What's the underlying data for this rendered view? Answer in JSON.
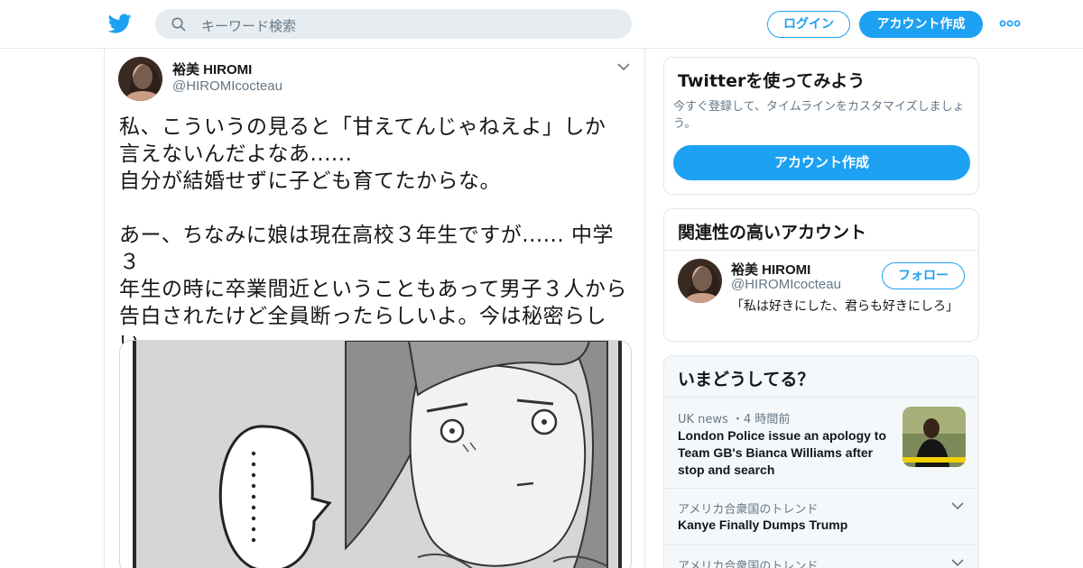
{
  "header": {
    "search_placeholder": "キーワード検索",
    "login_label": "ログイン",
    "signup_label": "アカウント作成",
    "accent_color": "#1da1f2"
  },
  "tweet": {
    "author_name": "裕美 HIROMI",
    "author_handle": "@HIROMIcocteau",
    "text": "私、こういうの見ると「甘えてんじゃねえよ」しか\n言えないんだよなあ......\n自分が結婚せずに子ども育てたからな。\n\nあー、ちなみに娘は現在高校３年生ですが...... 中学３\n年生の時に卒業間近ということもあって男子３人から\n告白されたけど全員断ったらしいよ。今は秘密らし\nい。"
  },
  "sidebar": {
    "signup_card": {
      "title": "Twitterを使ってみよう",
      "description": "今すぐ登録して、タイムラインをカスタマイズしましょう。",
      "cta_label": "アカウント作成"
    },
    "related_card": {
      "title": "関連性の高いアカウント",
      "account": {
        "name": "裕美 HIROMI",
        "handle": "@HIROMIcocteau",
        "follow_label": "フォロー",
        "bio": "「私は好きにした、君らも好きにしろ」"
      }
    },
    "trends_card": {
      "title": "いまどうしてる？",
      "items": [
        {
          "meta": "UK news ・4 時間前",
          "title": "London Police issue an apology to Team GB's Bianca Williams after stop and search"
        },
        {
          "meta": "アメリカ合衆国のトレンド",
          "title": "Kanye Finally Dumps Trump"
        },
        {
          "meta": "アメリカ合衆国のトレンド",
          "title": ""
        }
      ]
    }
  }
}
